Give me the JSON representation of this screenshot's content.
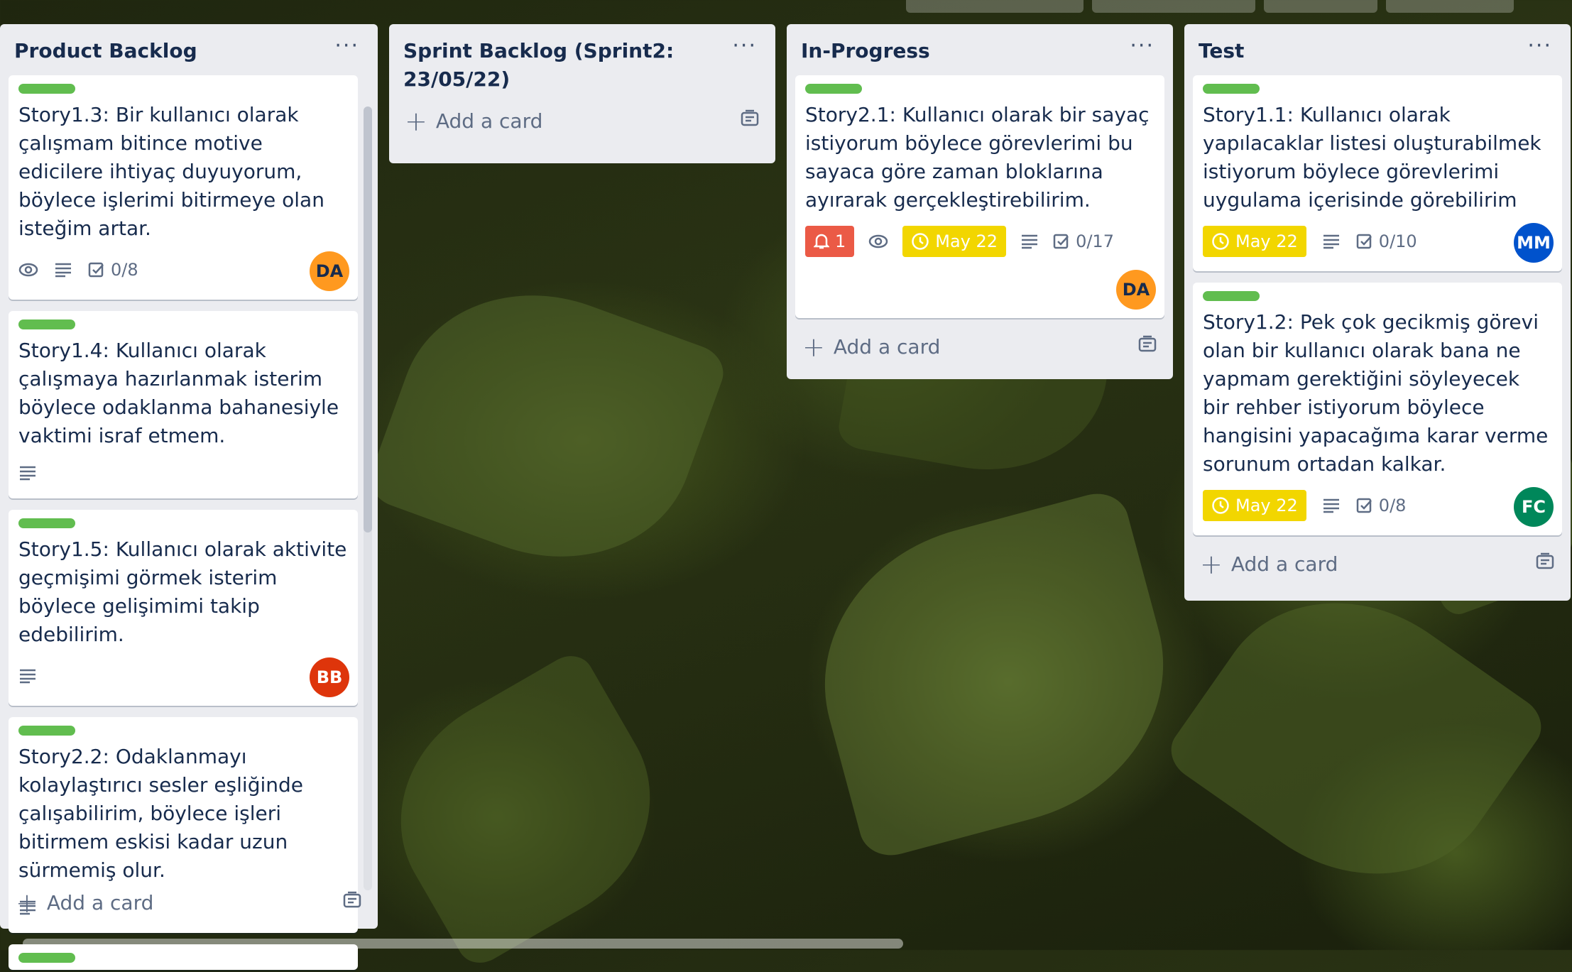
{
  "colors": {
    "label_green": "#61bd4f",
    "due_yellow": "#f2d600",
    "notification_red": "#eb5a46",
    "avatar_orange": "#ff991f",
    "avatar_red": "#de350b",
    "avatar_blue": "#0052cc",
    "avatar_green": "#00875a"
  },
  "add_card_label": "Add a card",
  "lists": {
    "product_backlog": {
      "title": "Product Backlog",
      "cards": [
        {
          "title": "Story1.3: Bir kullanıcı olarak çalışmam bitince motive edicilere ihtiyaç duyuyorum, böylece işlerimi bitirmeye olan isteğim artar.",
          "checklist": "0/8",
          "avatar": "DA"
        },
        {
          "title": "Story1.4: Kullanıcı olarak çalışmaya hazırlanmak isterim böylece odaklanma bahanesiyle vaktimi israf etmem."
        },
        {
          "title": "Story1.5: Kullanıcı olarak aktivite geçmişimi görmek isterim böylece gelişimimi takip edebilirim.",
          "avatar": "BB"
        },
        {
          "title": "Story2.2: Odaklanmayı kolaylaştırıcı sesler eşliğinde çalışabilirim, böylece işleri bitirmem eskisi kadar uzun sürmemiş olur."
        }
      ]
    },
    "sprint_backlog": {
      "title": "Sprint Backlog (Sprint2: 23/05/22)"
    },
    "in_progress": {
      "title": "In-Progress",
      "cards": [
        {
          "title": "Story2.1: Kullanıcı olarak bir sayaç istiyorum böylece görevlerimi bu sayaca göre zaman bloklarına ayırarak gerçekleştirebilirim.",
          "notifications": "1",
          "due": "May 22",
          "checklist": "0/17",
          "avatar": "DA"
        }
      ]
    },
    "test": {
      "title": "Test",
      "cards": [
        {
          "title": "Story1.1: Kullanıcı olarak yapılacaklar listesi oluşturabilmek istiyorum böylece görevlerimi uygulama içerisinde görebilirim",
          "due": "May 22",
          "checklist": "0/10",
          "avatar": "MM"
        },
        {
          "title": "Story1.2: Pek çok gecikmiş görevi olan bir kullanıcı olarak bana ne yapmam gerektiğini söyleyecek bir rehber istiyorum böylece hangisini yapacağıma karar verme sorunum ortadan kalkar.",
          "due": "May 22",
          "checklist": "0/8",
          "avatar": "FC"
        }
      ]
    }
  }
}
